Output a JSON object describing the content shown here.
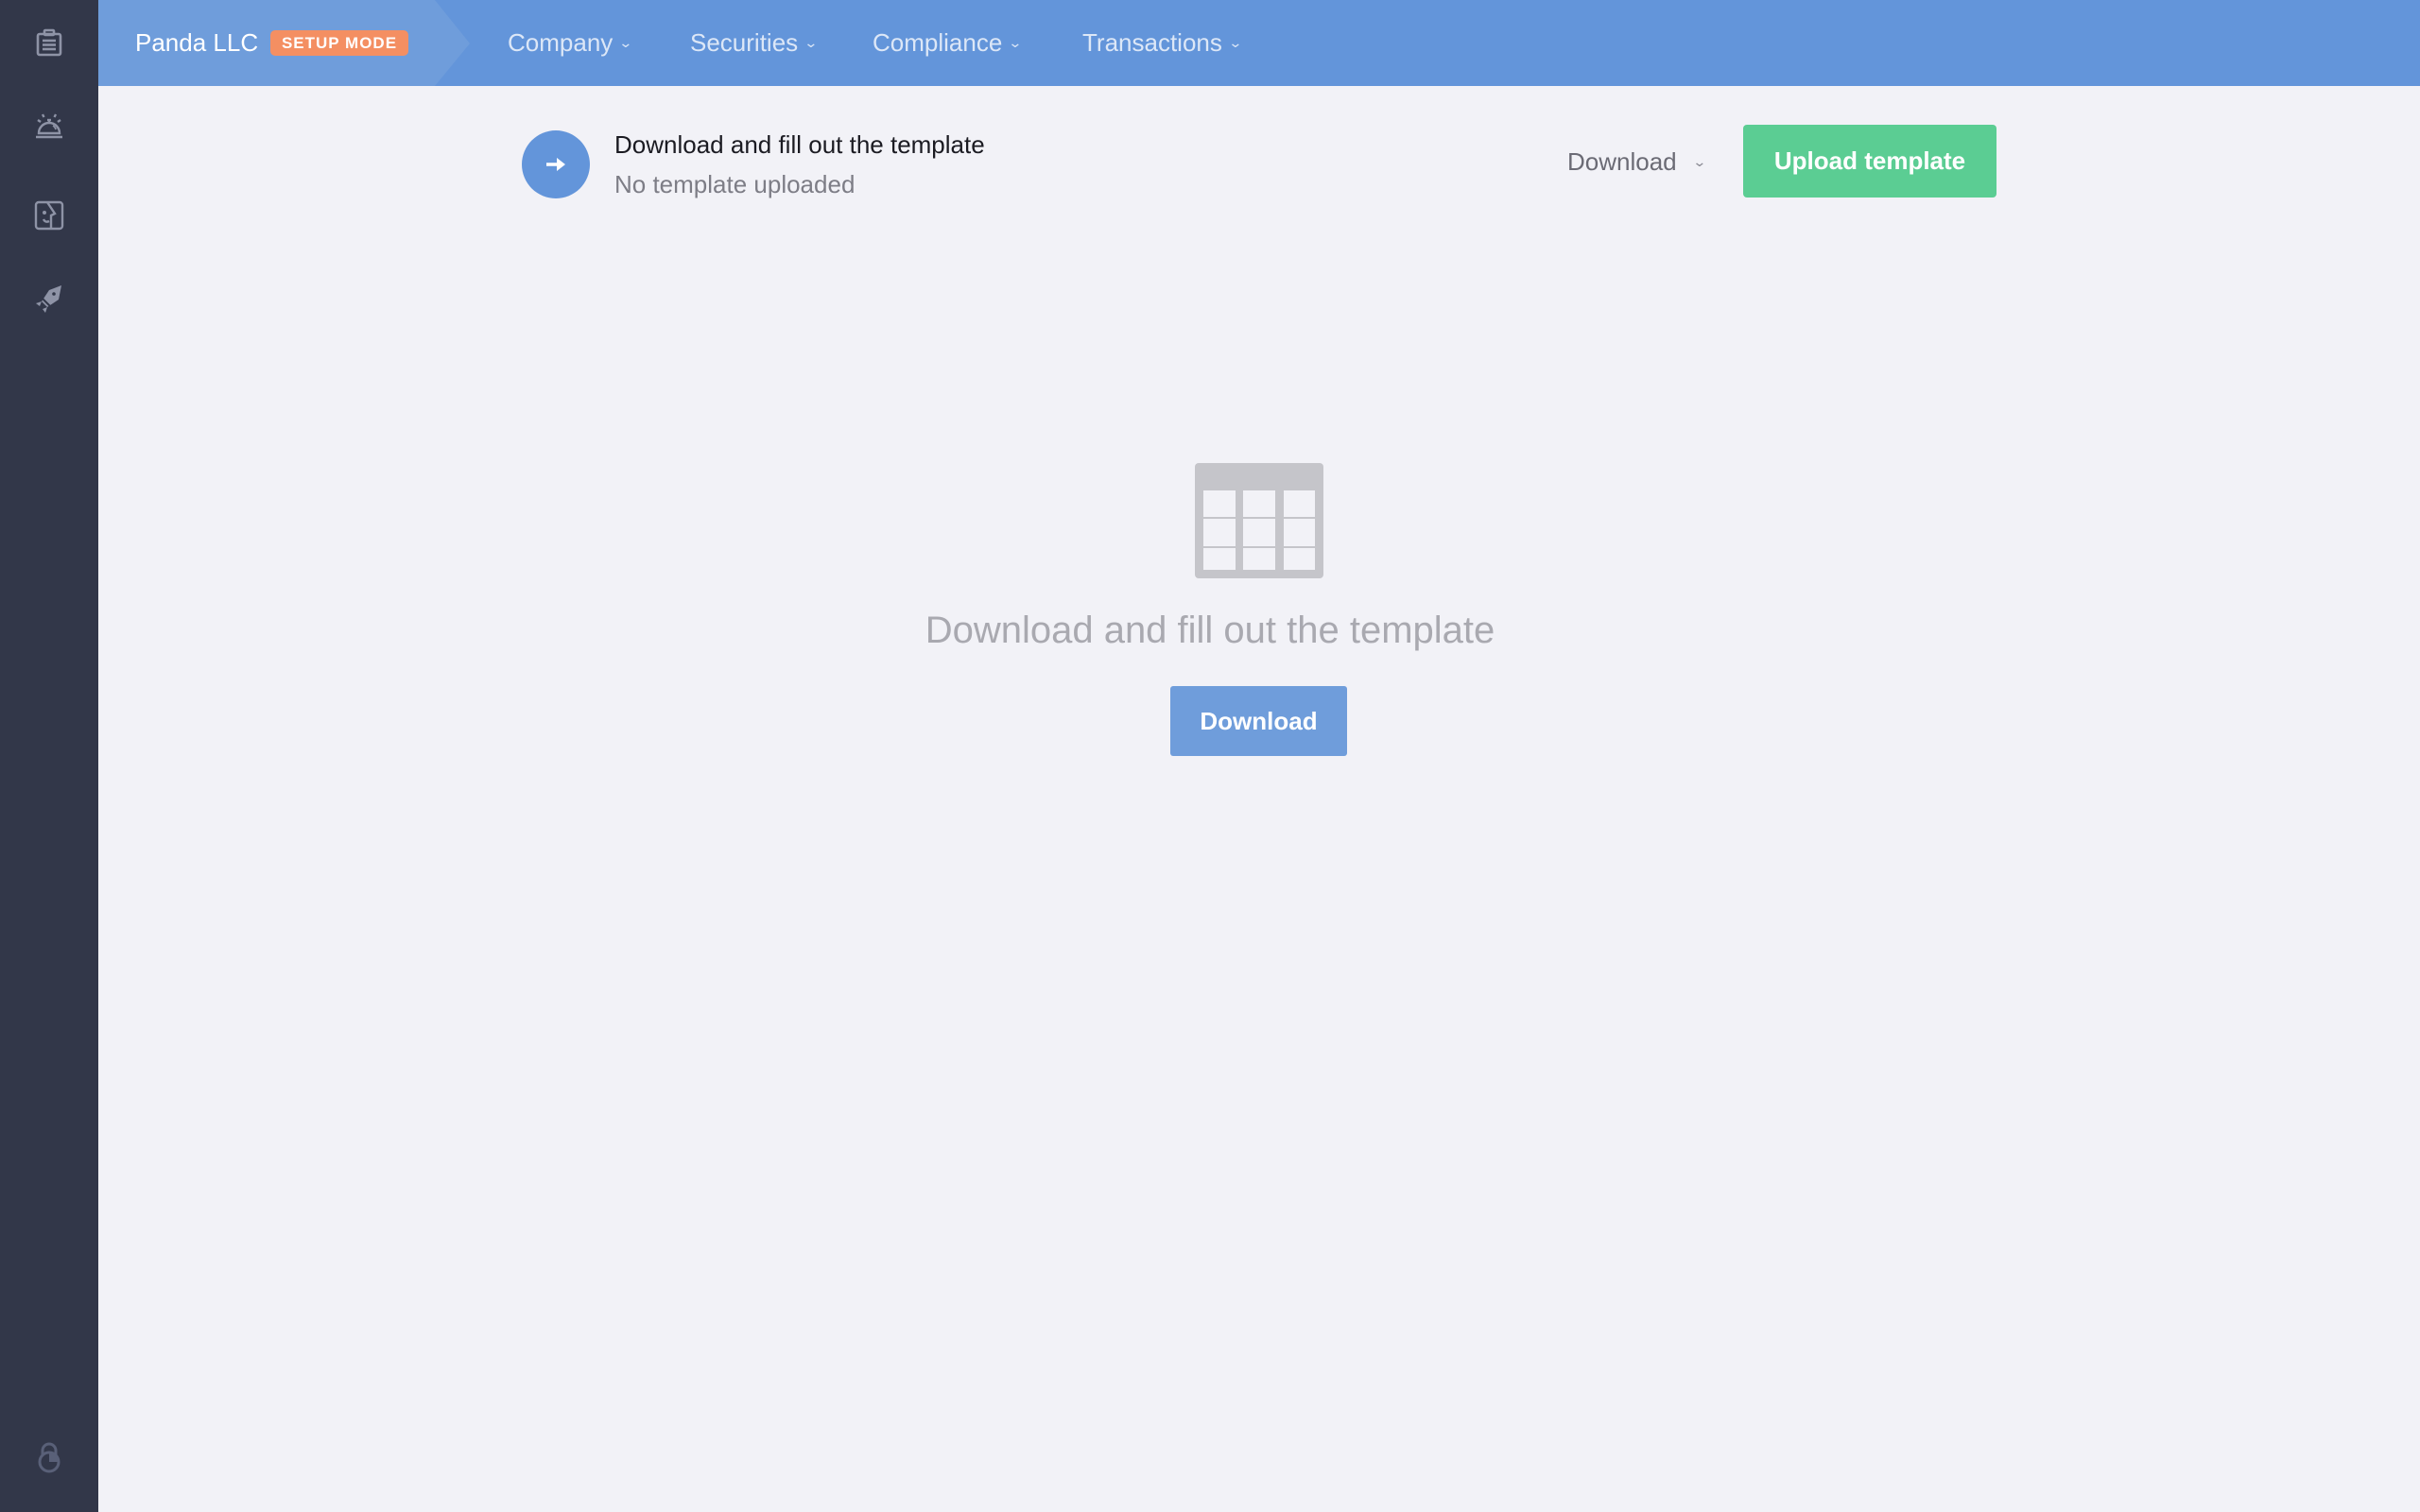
{
  "sidebar": {
    "items": [
      {
        "icon": "clipboard-icon"
      },
      {
        "icon": "concierge-bell-icon"
      },
      {
        "icon": "face-profile-icon"
      },
      {
        "icon": "rocket-icon"
      }
    ],
    "footer_icon": "lock-logo-icon"
  },
  "topbar": {
    "company_name": "Panda LLC",
    "mode_badge": "SETUP MODE",
    "nav": [
      {
        "label": "Company",
        "chevron": "⌄"
      },
      {
        "label": "Securities",
        "chevron": "⌄"
      },
      {
        "label": "Compliance",
        "chevron": "⌄"
      },
      {
        "label": "Transactions",
        "chevron": "⌄"
      }
    ]
  },
  "step": {
    "icon": "arrow-right-icon",
    "title": "Download and fill out the template",
    "status": "No template uploaded"
  },
  "actions": {
    "download_dropdown_label": "Download",
    "download_chevron": "⌄",
    "upload_label": "Upload template"
  },
  "empty_state": {
    "icon": "table-icon",
    "title": "Download and fill out the template",
    "button_label": "Download"
  },
  "colors": {
    "sidebar_bg": "#323749",
    "topbar_bg": "#6395da",
    "brand_bg": "#6f9ddb",
    "badge": "#f48f62",
    "upload_button": "#5bcd93",
    "download_button": "#6f9ddb",
    "page_bg": "#f2f2f7"
  }
}
